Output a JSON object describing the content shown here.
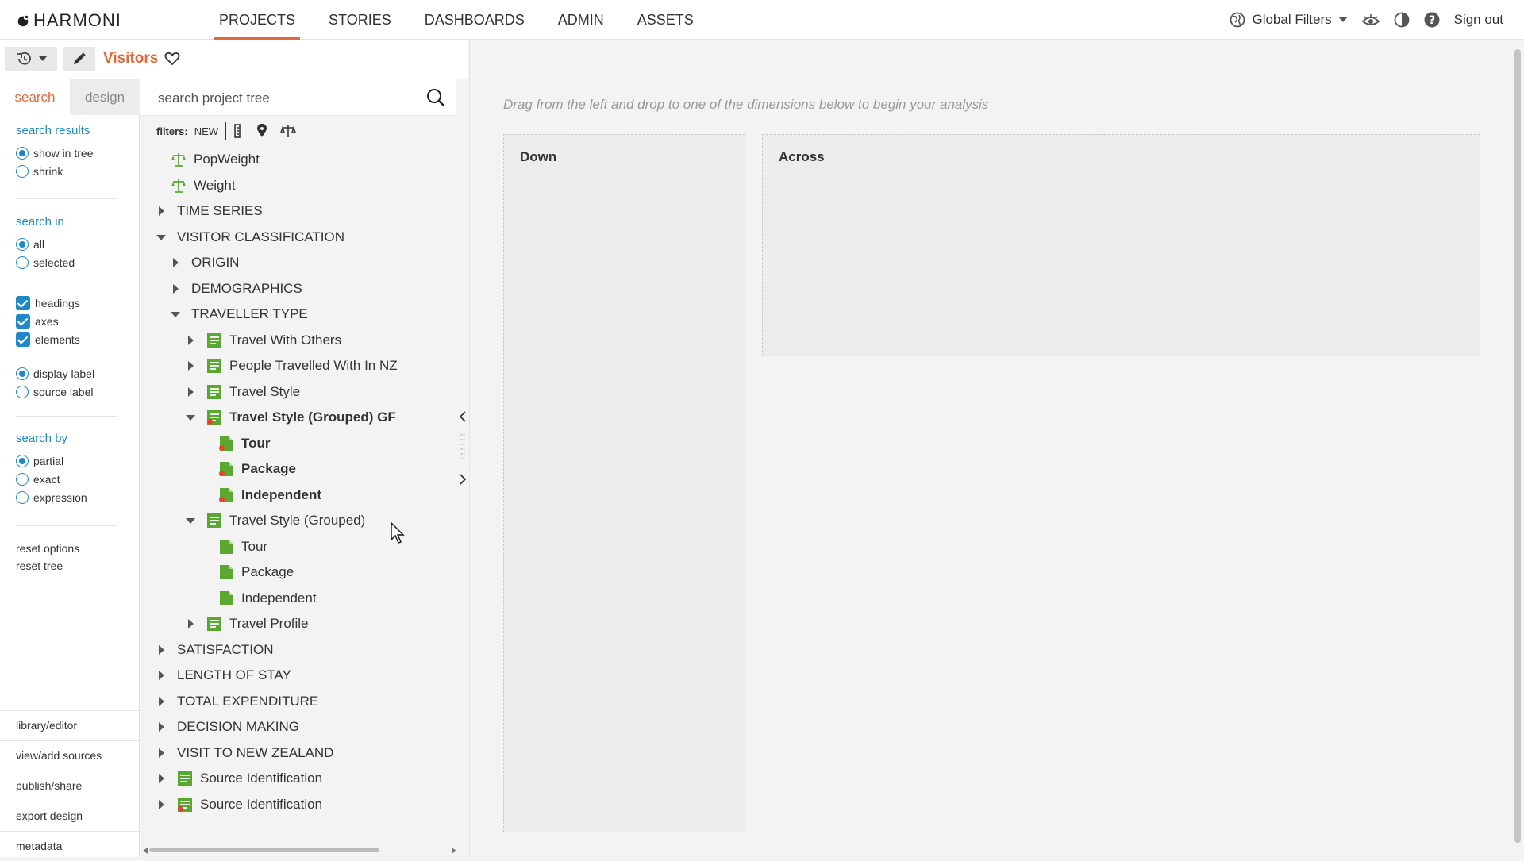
{
  "app": {
    "logo": "HARMONI",
    "nav": [
      "PROJECTS",
      "STORIES",
      "DASHBOARDS",
      "ADMIN",
      "ASSETS"
    ],
    "active_nav": "PROJECTS",
    "global_filters": "Global Filters",
    "sign_out": "Sign out",
    "accent": "#e06a3a",
    "link_color": "#1e88c8"
  },
  "page": {
    "title": "Visitors"
  },
  "sidebar": {
    "tabs": [
      "search",
      "design"
    ],
    "search_results": {
      "heading": "search results",
      "options": [
        "show in tree",
        "shrink"
      ],
      "selected": "show in tree"
    },
    "search_in": {
      "heading": "search in",
      "options": [
        "all",
        "selected"
      ],
      "selected": "all"
    },
    "checks": [
      "headings",
      "axes",
      "elements"
    ],
    "label_type": {
      "options": [
        "display label",
        "source label"
      ],
      "selected": "display label"
    },
    "search_by": {
      "heading": "search by",
      "options": [
        "partial",
        "exact",
        "expression"
      ],
      "selected": "partial"
    },
    "reset": [
      "reset options",
      "reset tree"
    ],
    "bottom_links": [
      "library/editor",
      "view/add sources",
      "publish/share",
      "export design",
      "metadata"
    ]
  },
  "tree_panel": {
    "search_placeholder": "search project tree",
    "filters_label": "filters:",
    "filters_new": "NEW",
    "nodes": [
      {
        "label": "PopWeight",
        "icon": "weight-icon"
      },
      {
        "label": "Weight",
        "icon": "weight-icon"
      },
      {
        "label": "TIME SERIES",
        "icon": "folder"
      },
      {
        "label": "VISITOR CLASSIFICATION",
        "icon": "folder"
      },
      {
        "label": "ORIGIN",
        "icon": "folder"
      },
      {
        "label": "DEMOGRAPHICS",
        "icon": "folder"
      },
      {
        "label": "TRAVELLER TYPE",
        "icon": "folder"
      },
      {
        "label": "Travel With Others",
        "icon": "variable-icon"
      },
      {
        "label": "People Travelled With In NZ",
        "icon": "variable-icon"
      },
      {
        "label": "Travel Style",
        "icon": "variable-icon"
      },
      {
        "label": "Travel Style (Grouped) GF",
        "icon": "variable-filter-icon"
      },
      {
        "label": "Tour",
        "icon": "code-filter-icon"
      },
      {
        "label": "Package",
        "icon": "code-filter-icon"
      },
      {
        "label": "Independent",
        "icon": "code-filter-icon"
      },
      {
        "label": "Travel Style (Grouped)",
        "icon": "variable-icon"
      },
      {
        "label": "Tour",
        "icon": "code-icon"
      },
      {
        "label": "Package",
        "icon": "code-icon"
      },
      {
        "label": "Independent",
        "icon": "code-icon"
      },
      {
        "label": "Travel Profile",
        "icon": "variable-icon"
      },
      {
        "label": "SATISFACTION",
        "icon": "folder"
      },
      {
        "label": "LENGTH OF STAY",
        "icon": "folder"
      },
      {
        "label": "TOTAL EXPENDITURE",
        "icon": "folder"
      },
      {
        "label": "DECISION MAKING",
        "icon": "folder"
      },
      {
        "label": "VISIT TO NEW ZEALAND",
        "icon": "folder"
      },
      {
        "label": "Source Identification",
        "icon": "variable-icon"
      },
      {
        "label": "Source Identification",
        "icon": "variable-filter-icon"
      }
    ]
  },
  "canvas": {
    "hint": "Drag from the left and drop to one of the dimensions below to begin your analysis",
    "down_label": "Down",
    "across_label": "Across"
  }
}
